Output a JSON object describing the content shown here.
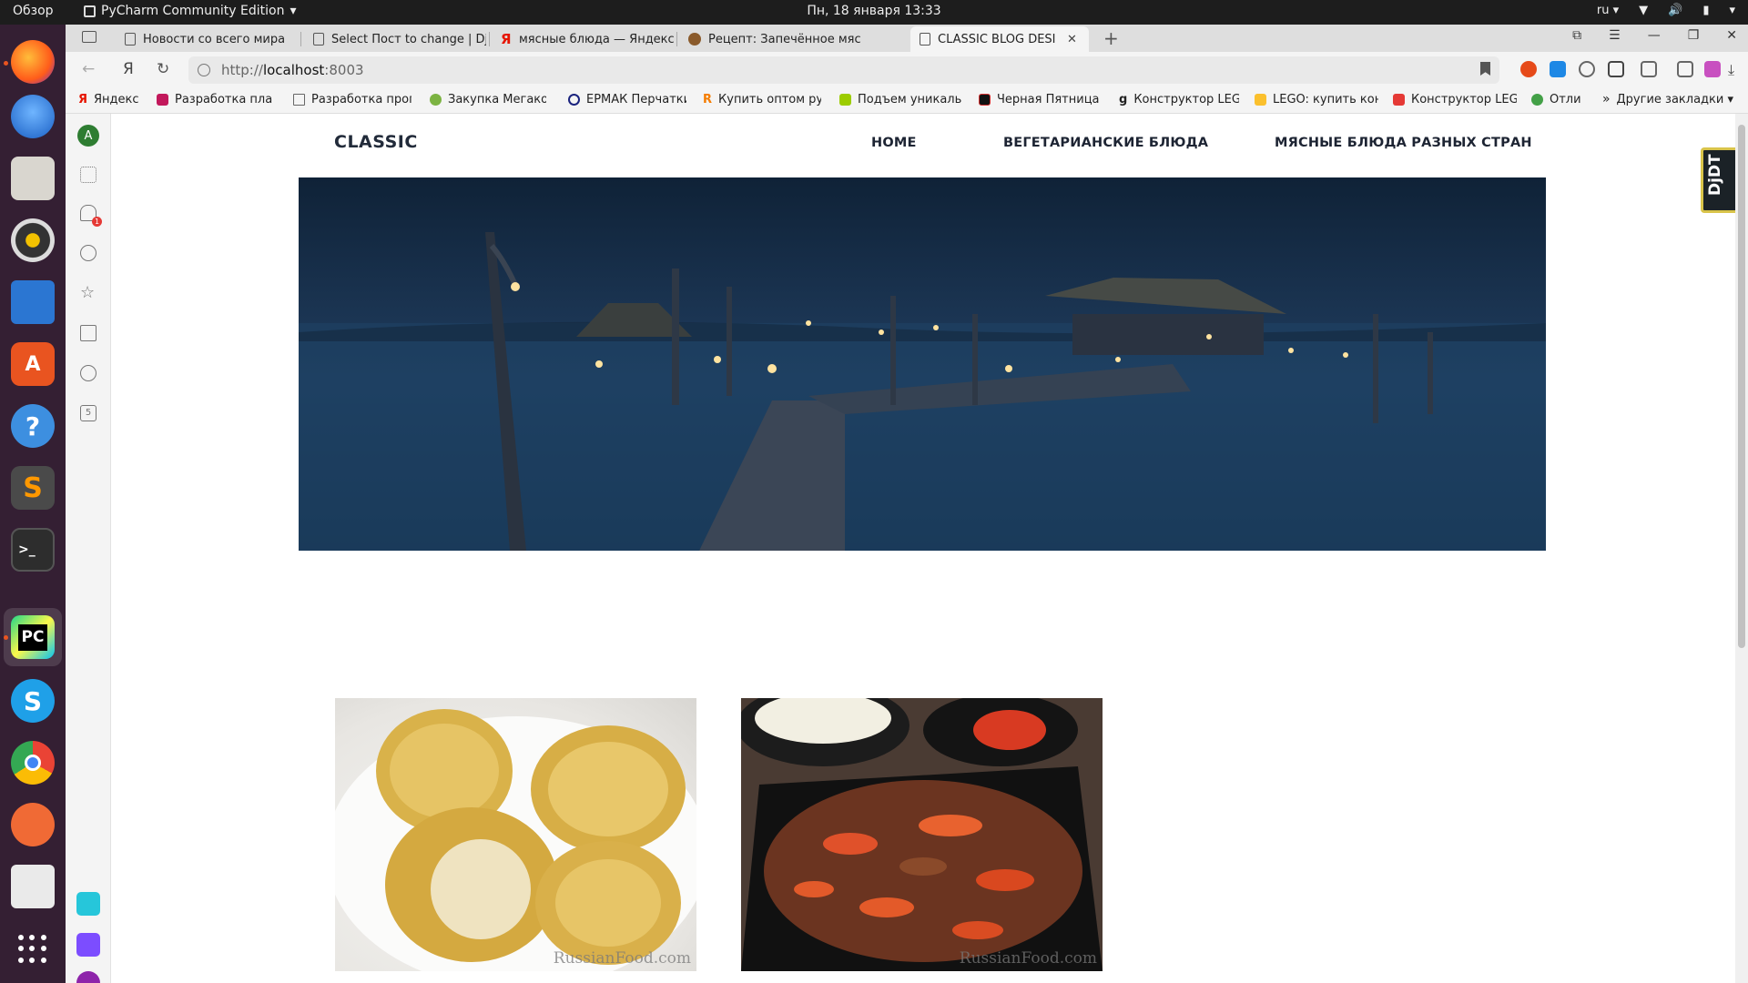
{
  "os": {
    "activities": "Обзор",
    "app_name": "PyCharm Community Edition",
    "clock": "Пн, 18 января  13:33",
    "language": "ru"
  },
  "dock": {
    "items": [
      "firefox-icon",
      "thunderbird-icon",
      "files-icon",
      "rhythmbox-icon",
      "writer-icon",
      "software-icon",
      "help-icon",
      "sublime-icon",
      "terminal-icon",
      "pycharm-icon",
      "skype-icon",
      "chrome-icon",
      "inkscape-icon",
      "viewer-icon"
    ],
    "pycharm_label": "PC"
  },
  "browser": {
    "tabs": [
      {
        "label": "Новости со всего мира",
        "icon": "page-icon"
      },
      {
        "label": "Select Пост to change | Dja",
        "icon": "page-icon"
      },
      {
        "label": "мясные блюда — Яндекс",
        "icon": "yandex-icon"
      },
      {
        "label": "Рецепт: Запечённое мясо",
        "icon": "recipe-icon"
      },
      {
        "label": "CLASSIC BLOG DESIGN",
        "icon": "page-icon",
        "active": true
      }
    ],
    "url_scheme": "http://",
    "url_host": "localhost",
    "url_port": ":8003",
    "bookmarks": [
      "Яндекс",
      "Разработка план",
      "Разработка прог",
      "Закупка Мегаком",
      "ЕРМАК Перчатки",
      "Купить оптом ру",
      "Подъем уникальн",
      "Черная Пятница",
      "Конструктор LEG",
      "LEGO: купить кон",
      "Конструктор LEG",
      "Отли"
    ],
    "other_bookmarks": "Другие закладки",
    "sidebar": {
      "avatar": "A",
      "badge": "1",
      "counter": "5"
    }
  },
  "site": {
    "brand": "CLASSIC",
    "nav": [
      "HOME",
      "ВЕГЕТАРИАНСКИЕ БЛЮДА",
      "МЯСНЫЕ БЛЮДА РАЗНЫХ СТРАН"
    ],
    "watermark_1": "RussianFood.com",
    "watermark_2": "RussianFood.com",
    "debug_toolbar": "DjDT"
  },
  "colors": {
    "brand_text": "#222b3a",
    "hero": "#1b3553",
    "dock": "#341f33",
    "accent": "#e95420"
  }
}
